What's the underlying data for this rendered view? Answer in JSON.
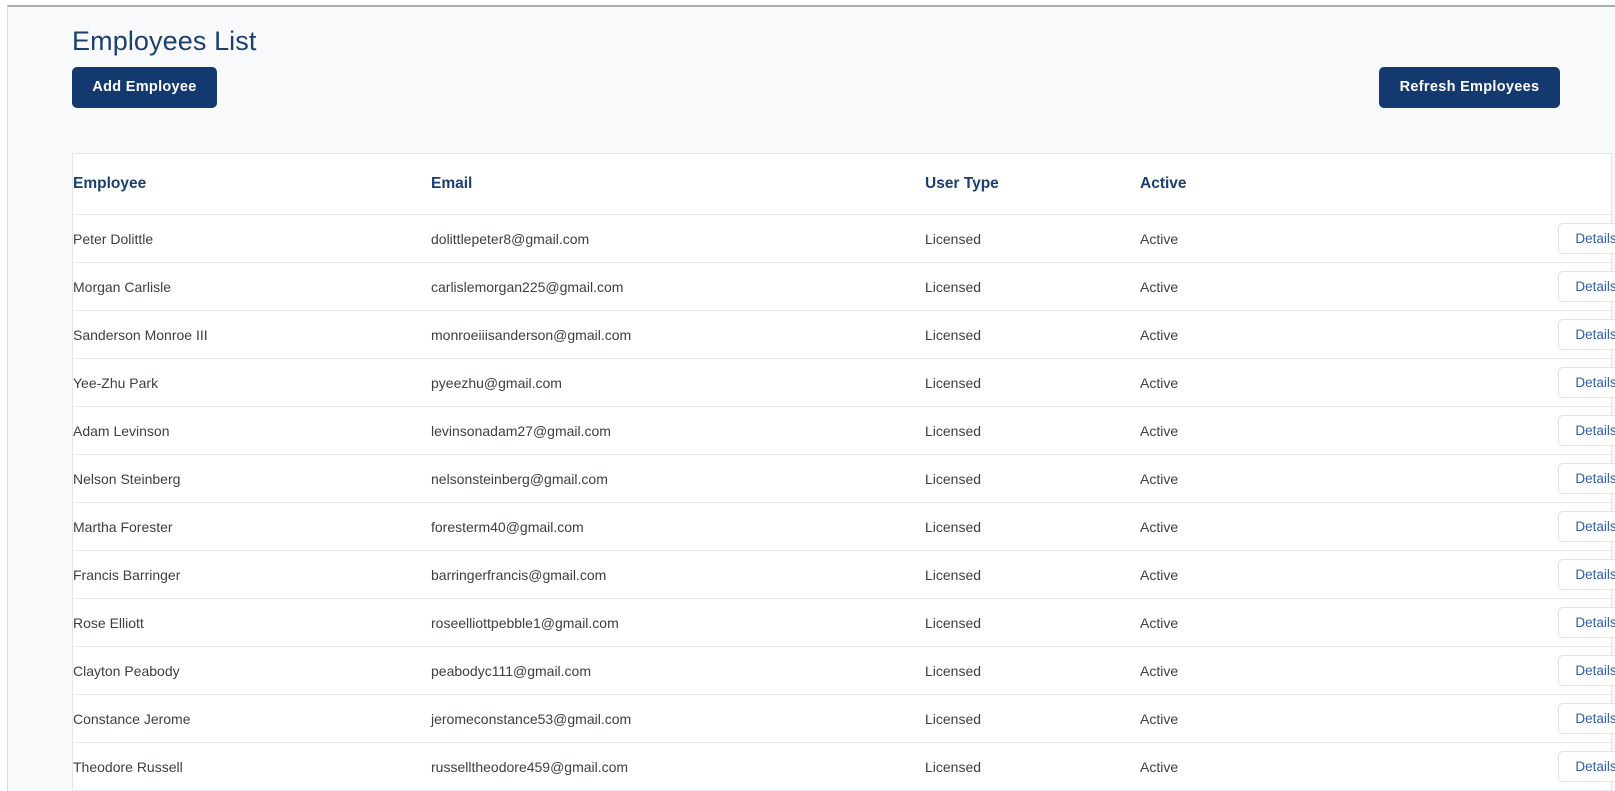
{
  "page": {
    "title": "Employees List"
  },
  "toolbar": {
    "add_label": "Add Employee",
    "refresh_label": "Refresh Employees"
  },
  "table": {
    "columns": [
      {
        "key": "employee",
        "label": "Employee"
      },
      {
        "key": "email",
        "label": "Email"
      },
      {
        "key": "user_type",
        "label": "User Type"
      },
      {
        "key": "active",
        "label": "Active"
      },
      {
        "key": "actions",
        "label": ""
      }
    ],
    "row_action_label": "Details",
    "rows": [
      {
        "employee": "Peter Dolittle",
        "email": "dolittlepeter8@gmail.com",
        "user_type": "Licensed",
        "active": "Active"
      },
      {
        "employee": "Morgan Carlisle",
        "email": "carlislemorgan225@gmail.com",
        "user_type": "Licensed",
        "active": "Active"
      },
      {
        "employee": "Sanderson Monroe III",
        "email": "monroeiiisanderson@gmail.com",
        "user_type": "Licensed",
        "active": "Active"
      },
      {
        "employee": "Yee-Zhu Park",
        "email": "pyeezhu@gmail.com",
        "user_type": "Licensed",
        "active": "Active"
      },
      {
        "employee": "Adam Levinson",
        "email": "levinsonadam27@gmail.com",
        "user_type": "Licensed",
        "active": "Active"
      },
      {
        "employee": "Nelson Steinberg",
        "email": "nelsonsteinberg@gmail.com",
        "user_type": "Licensed",
        "active": "Active"
      },
      {
        "employee": "Martha Forester",
        "email": "foresterm40@gmail.com",
        "user_type": "Licensed",
        "active": "Active"
      },
      {
        "employee": "Francis Barringer",
        "email": "barringerfrancis@gmail.com",
        "user_type": "Licensed",
        "active": "Active"
      },
      {
        "employee": "Rose Elliott",
        "email": "roseelliottpebble1@gmail.com",
        "user_type": "Licensed",
        "active": "Active"
      },
      {
        "employee": "Clayton Peabody",
        "email": "peabodyc111@gmail.com",
        "user_type": "Licensed",
        "active": "Active"
      },
      {
        "employee": "Constance Jerome",
        "email": "jeromeconstance53@gmail.com",
        "user_type": "Licensed",
        "active": "Active"
      },
      {
        "employee": "Theodore Russell",
        "email": "russelltheodore459@gmail.com",
        "user_type": "Licensed",
        "active": "Active"
      }
    ]
  },
  "colors": {
    "brand_navy": "#14396e",
    "title_navy": "#1c3f6e",
    "status_green": "#2a7a34",
    "link_blue": "#2f5fa8",
    "page_bg": "#f8f9fa"
  }
}
